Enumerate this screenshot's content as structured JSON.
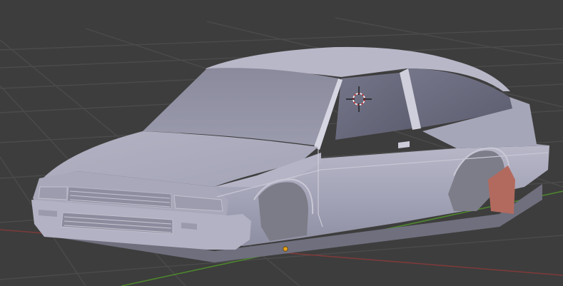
{
  "viewport": {
    "kind": "3d-viewport",
    "background": "#3d3d3d",
    "grid_color": "#4c4c4c",
    "x_axis_color": "#8a3a3a",
    "y_axis_color": "#4f8a2e"
  },
  "scene": {
    "object": "car-body-shell",
    "body_color": "#a9a9bb",
    "glass_color": "#6c6c7e",
    "wheel_well_color": "#85858e",
    "mudflap_color": "#b86a60",
    "cursor": "3d-cursor",
    "origin": "object-origin"
  }
}
